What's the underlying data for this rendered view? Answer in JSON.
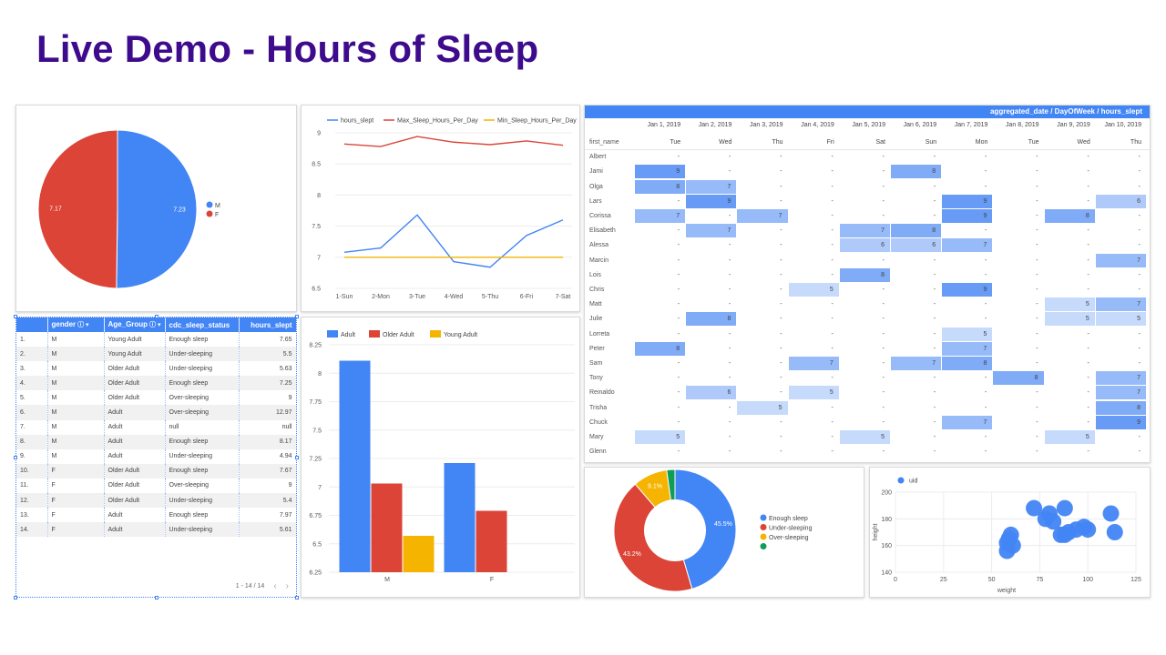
{
  "page": {
    "title": "Live Demo - Hours of Sleep"
  },
  "colors": {
    "blue": "#4285f4",
    "red": "#db4437",
    "yellow": "#f4b400",
    "green": "#0f9d58",
    "title": "#3d0b8c"
  },
  "pie": {
    "chart_data": {
      "type": "pie",
      "labels": [
        "M",
        "F"
      ],
      "values": [
        7.23,
        7.17
      ],
      "value_labels": [
        "7.23",
        "7.17"
      ],
      "colors": [
        "#4285f4",
        "#db4437"
      ],
      "legend_position": "right"
    }
  },
  "line": {
    "chart_data": {
      "type": "line",
      "categories": [
        "1-Sun",
        "2-Mon",
        "3-Tue",
        "4-Wed",
        "5-Thu",
        "6-Fri",
        "7-Sat"
      ],
      "series": [
        {
          "name": "hours_slept",
          "color": "#4285f4",
          "values": [
            7.08,
            7.15,
            7.68,
            6.93,
            6.84,
            7.35,
            7.6
          ]
        },
        {
          "name": "Max_Sleep_Hours_Per_Day",
          "color": "#db4437",
          "values": [
            8.82,
            8.78,
            8.94,
            8.85,
            8.81,
            8.87,
            8.8
          ]
        },
        {
          "name": "Min_Sleep_Hours_Per_Day",
          "color": "#f4b400",
          "values": [
            7,
            7,
            7,
            7,
            7,
            7,
            7
          ]
        }
      ],
      "yticks": [
        "9",
        "8.5",
        "8",
        "7.5",
        "7",
        "6.5"
      ],
      "ylim": [
        6.5,
        9
      ],
      "legend_position": "top"
    }
  },
  "table": {
    "headers": [
      "",
      "gender",
      "Age_Group",
      "cdc_sleep_status",
      "hours_slept"
    ],
    "rows": [
      [
        "1.",
        "M",
        "Young Adult",
        "Enough sleep",
        "7.65"
      ],
      [
        "2.",
        "M",
        "Young Adult",
        "Under-sleeping",
        "5.5"
      ],
      [
        "3.",
        "M",
        "Older Adult",
        "Under-sleeping",
        "5.63"
      ],
      [
        "4.",
        "M",
        "Older Adult",
        "Enough sleep",
        "7.25"
      ],
      [
        "5.",
        "M",
        "Older Adult",
        "Over-sleeping",
        "9"
      ],
      [
        "6.",
        "M",
        "Adult",
        "Over-sleeping",
        "12.97"
      ],
      [
        "7.",
        "M",
        "Adult",
        "null",
        "null"
      ],
      [
        "8.",
        "M",
        "Adult",
        "Enough sleep",
        "8.17"
      ],
      [
        "9.",
        "M",
        "Adult",
        "Under-sleeping",
        "4.94"
      ],
      [
        "10.",
        "F",
        "Older Adult",
        "Enough sleep",
        "7.67"
      ],
      [
        "11.",
        "F",
        "Older Adult",
        "Over-sleeping",
        "9"
      ],
      [
        "12.",
        "F",
        "Older Adult",
        "Under-sleeping",
        "5.4"
      ],
      [
        "13.",
        "F",
        "Adult",
        "Enough sleep",
        "7.97"
      ],
      [
        "14.",
        "F",
        "Adult",
        "Under-sleeping",
        "5.61"
      ]
    ],
    "pager_text": "1 - 14 / 14"
  },
  "bar": {
    "chart_data": {
      "type": "bar",
      "categories": [
        "M",
        "F"
      ],
      "series": [
        {
          "name": "Adult",
          "color": "#4285f4",
          "values": [
            8.11,
            7.21
          ]
        },
        {
          "name": "Older Adult",
          "color": "#db4437",
          "values": [
            7.03,
            6.79
          ]
        },
        {
          "name": "Young Adult",
          "color": "#f4b400",
          "values": [
            6.57,
            null
          ]
        }
      ],
      "yticks": [
        "8.25",
        "8",
        "7.75",
        "7.5",
        "7.25",
        "7",
        "6.75",
        "6.5",
        "6.25"
      ],
      "ylim": [
        6.25,
        8.25
      ],
      "legend_position": "top"
    }
  },
  "pivot": {
    "header": "aggregated_date / DayOfWeek / hours_slept",
    "row_label": "first_name",
    "dates": [
      "Jan 1, 2019",
      "Jan 2, 2019",
      "Jan 3, 2019",
      "Jan 4, 2019",
      "Jan 5, 2019",
      "Jan 6, 2019",
      "Jan 7, 2019",
      "Jan 8, 2019",
      "Jan 9, 2019",
      "Jan 10, 2019"
    ],
    "days": [
      "Tue",
      "Wed",
      "Thu",
      "Fri",
      "Sat",
      "Sun",
      "Mon",
      "Tue",
      "Wed",
      "Thu"
    ],
    "names": [
      "Albert",
      "Jami",
      "Olga",
      "Lars",
      "Corissa",
      "Elisabeth",
      "Alessa",
      "Marcin",
      "Lois",
      "Chris",
      "Matt",
      "Julie",
      "Lorreta",
      "Peter",
      "Sam",
      "Tony",
      "Reinaldo",
      "Trisha",
      "Chuck",
      "Mary",
      "Glenn"
    ],
    "cells": [
      [
        "-",
        "-",
        "-",
        "-",
        "-",
        "-",
        "-",
        "-",
        "-",
        "-"
      ],
      [
        "9",
        "-",
        "-",
        "-",
        "-",
        "8",
        "-",
        "-",
        "-",
        "-"
      ],
      [
        "8",
        "7",
        "-",
        "-",
        "-",
        "-",
        "-",
        "-",
        "-",
        "-"
      ],
      [
        "-",
        "9",
        "-",
        "-",
        "-",
        "-",
        "9",
        "-",
        "-",
        "6"
      ],
      [
        "7",
        "-",
        "7",
        "-",
        "-",
        "-",
        "9",
        "-",
        "8",
        "-"
      ],
      [
        "-",
        "7",
        "-",
        "-",
        "7",
        "8",
        "-",
        "-",
        "-",
        "-"
      ],
      [
        "-",
        "-",
        "-",
        "-",
        "6",
        "6",
        "7",
        "-",
        "-",
        "-"
      ],
      [
        "-",
        "-",
        "-",
        "-",
        "-",
        "-",
        "-",
        "-",
        "-",
        "7"
      ],
      [
        "-",
        "-",
        "-",
        "-",
        "8",
        "-",
        "-",
        "-",
        "-",
        "-"
      ],
      [
        "-",
        "-",
        "-",
        "5",
        "-",
        "-",
        "9",
        "-",
        "-",
        "-"
      ],
      [
        "-",
        "-",
        "-",
        "-",
        "-",
        "-",
        "-",
        "-",
        "5",
        "7"
      ],
      [
        "-",
        "8",
        "-",
        "-",
        "-",
        "-",
        "-",
        "-",
        "5",
        "5"
      ],
      [
        "-",
        "-",
        "-",
        "-",
        "-",
        "-",
        "5",
        "-",
        "-",
        "-"
      ],
      [
        "8",
        "-",
        "-",
        "-",
        "-",
        "-",
        "7",
        "-",
        "-",
        "-"
      ],
      [
        "-",
        "-",
        "-",
        "7",
        "-",
        "7",
        "8",
        "-",
        "-",
        "-"
      ],
      [
        "-",
        "-",
        "-",
        "-",
        "-",
        "-",
        "-",
        "8",
        "-",
        "7"
      ],
      [
        "-",
        "6",
        "-",
        "5",
        "-",
        "-",
        "-",
        "-",
        "-",
        "7"
      ],
      [
        "-",
        "-",
        "5",
        "-",
        "-",
        "-",
        "-",
        "-",
        "-",
        "8"
      ],
      [
        "-",
        "-",
        "-",
        "-",
        "-",
        "-",
        "7",
        "-",
        "-",
        "9"
      ],
      [
        "5",
        "-",
        "-",
        "-",
        "5",
        "-",
        "-",
        "-",
        "5",
        "-"
      ],
      [
        "-",
        "-",
        "-",
        "-",
        "-",
        "-",
        "-",
        "-",
        "-",
        "-"
      ]
    ]
  },
  "donut": {
    "chart_data": {
      "type": "pie",
      "labels": [
        "Enough sleep",
        "Under-sleeping",
        "Over-sleeping",
        ""
      ],
      "values": [
        45.5,
        43.2,
        9.1,
        2.2
      ],
      "value_labels": [
        "45.5%",
        "43.2%",
        "9.1%",
        ""
      ],
      "colors": [
        "#4285f4",
        "#db4437",
        "#f4b400",
        "#0f9d58"
      ],
      "legend_position": "right"
    }
  },
  "scatter": {
    "chart_data": {
      "type": "scatter",
      "series": [
        {
          "name": "uid",
          "color": "#4285f4",
          "points": [
            [
              58,
              156
            ],
            [
              58,
              162
            ],
            [
              59,
              165
            ],
            [
              60,
              168
            ],
            [
              61,
              160
            ],
            [
              72,
              188
            ],
            [
              78,
              180
            ],
            [
              80,
              184
            ],
            [
              82,
              178
            ],
            [
              88,
              188
            ],
            [
              86,
              168
            ],
            [
              88,
              168
            ],
            [
              90,
              170
            ],
            [
              94,
              172
            ],
            [
              98,
              174
            ],
            [
              100,
              172
            ],
            [
              112,
              184
            ],
            [
              114,
              170
            ]
          ]
        }
      ],
      "xlabel": "weight",
      "ylabel": "height",
      "xticks": [
        "0",
        "25",
        "50",
        "75",
        "100",
        "125"
      ],
      "yticks": [
        "200",
        "180",
        "160",
        "140"
      ],
      "xlim": [
        0,
        125
      ],
      "ylim": [
        140,
        200
      ],
      "legend_position": "top"
    }
  }
}
